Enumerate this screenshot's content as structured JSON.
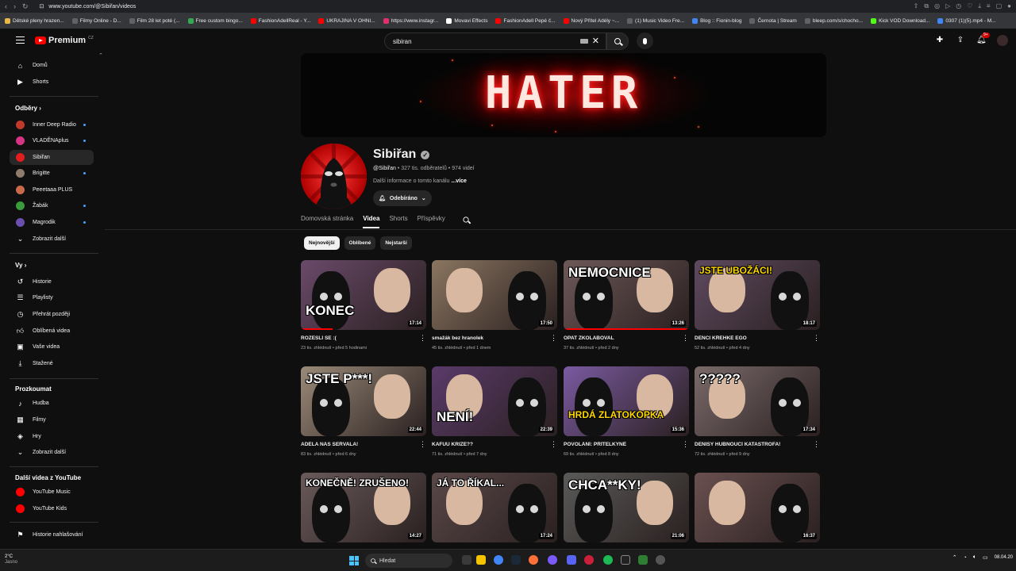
{
  "browser": {
    "url": "www.youtube.com/@Sibiřan/videos",
    "bookmarks": [
      {
        "label": "Dětské pleny hrazen...",
        "color": "#e8b84a"
      },
      {
        "label": "Filmy Online - D...",
        "color": "#5f6368"
      },
      {
        "label": "Film 28 let poté (...",
        "color": "#5f6368"
      },
      {
        "label": "Free custom bingo...",
        "color": "#34a853"
      },
      {
        "label": "FashionAdellReal - Y...",
        "color": "#ff0000"
      },
      {
        "label": "UKRAJINA V OHNI...",
        "color": "#ff0000"
      },
      {
        "label": "https://www.instagr...",
        "color": "#e1306c"
      },
      {
        "label": "Movavi Effects",
        "color": "#ffffff"
      },
      {
        "label": "FashionAdell Pepé č...",
        "color": "#ff0000"
      },
      {
        "label": "Nový Přítel Adély ~...",
        "color": "#ff0000"
      },
      {
        "label": "(1) Music Video Fre...",
        "color": "#5f6368"
      },
      {
        "label": "Blog :: Fionin-blog",
        "color": "#4285f4"
      },
      {
        "label": "Černota | Stream",
        "color": "#5f6368"
      },
      {
        "label": "bleep.com/s/chocho...",
        "color": "#5f6368"
      },
      {
        "label": "Kick VOD Download...",
        "color": "#53fc18"
      },
      {
        "label": "0307 (1)(5).mp4 - M...",
        "color": "#4285f4"
      }
    ]
  },
  "header": {
    "logo_text": "Premium",
    "logo_region": "CZ",
    "search_value": "sibiran",
    "notif_count": "9+"
  },
  "sidebar": {
    "main": [
      {
        "label": "Domů",
        "icon": "home-icon"
      },
      {
        "label": "Shorts",
        "icon": "shorts-icon"
      }
    ],
    "subs_title": "Odběry",
    "subs": [
      {
        "label": "Inner Deep Radio",
        "color": "#c0392b",
        "dot": true
      },
      {
        "label": "VLADĚNAplus",
        "color": "#d63384",
        "dot": true
      },
      {
        "label": "Sibiřan",
        "color": "#e11d1d",
        "dot": false,
        "active": true
      },
      {
        "label": "Brigitte",
        "color": "#8e7b6b",
        "dot": true
      },
      {
        "label": "Peeetaaa PLUS",
        "color": "#c96a4a",
        "dot": false
      },
      {
        "label": "Žabák",
        "color": "#3b9a3b",
        "dot": true
      },
      {
        "label": "Magrodik",
        "color": "#6b4fb0",
        "dot": true
      }
    ],
    "show_more": "Zobrazit další",
    "you_title": "Vy",
    "you": [
      {
        "label": "Historie",
        "icon": "history-icon"
      },
      {
        "label": "Playlisty",
        "icon": "playlist-icon"
      },
      {
        "label": "Přehrát později",
        "icon": "clock-icon"
      },
      {
        "label": "Oblíbená videa",
        "icon": "like-icon"
      },
      {
        "label": "Vaše videa",
        "icon": "video-icon"
      },
      {
        "label": "Stažené",
        "icon": "download-icon"
      }
    ],
    "explore_title": "Prozkoumat",
    "explore": [
      {
        "label": "Hudba",
        "icon": "music-icon"
      },
      {
        "label": "Filmy",
        "icon": "film-icon"
      },
      {
        "label": "Hry",
        "icon": "gamepad-icon"
      }
    ],
    "explore_more": "Zobrazit další",
    "more_title": "Další videa z YouTube",
    "more": [
      {
        "label": "YouTube Music",
        "color": "#ff0000"
      },
      {
        "label": "YouTube Kids",
        "color": "#ff0000"
      }
    ],
    "report": "Historie nahlašování"
  },
  "channel": {
    "banner_text": "HATER",
    "name": "Sibiřan",
    "handle": "@Sibiřan",
    "subs": "327 tis. odběratelů",
    "videos": "974 videí",
    "more_text": "Další informace o tomto kanálu",
    "more_link": "...více",
    "sub_label": "Odebíráno"
  },
  "tabs": [
    "Domovská stránka",
    "Videa",
    "Shorts",
    "Příspěvky"
  ],
  "chips": [
    "Nejnovější",
    "Oblíbené",
    "Nejstarší"
  ],
  "videos": [
    {
      "title": "ROZEŠLI SE :(",
      "meta": "23 tis. zhlédnutí • před 5 hodinami",
      "duration": "17:14",
      "overlay": "KONEC",
      "bg": "#6a4a6a",
      "progress": 0.25
    },
    {
      "title": "smažák bez hranolek",
      "meta": "45 tis. zhlédnutí • před 1 dnem",
      "duration": "17:50",
      "overlay": "",
      "bg": "#8a7560",
      "progress": 0
    },
    {
      "title": "OPAT ZKOLABOVAL",
      "meta": "37 tis. zhlédnutí • před 2 dny",
      "duration": "13:26",
      "overlay": "NEMOCNICE",
      "bg": "#6e5858",
      "progress": 1.0
    },
    {
      "title": "DENČI KŘEHKÉ EGO",
      "meta": "52 tis. zhlédnutí • před 4 dny",
      "duration": "18:17",
      "overlay": "JSTE UBOŽÁCI!",
      "bg": "#5e4a60",
      "progress": 0
    },
    {
      "title": "ADÉLA NÁS SEŘVALA!",
      "meta": "83 tis. zhlédnutí • před 6 dny",
      "duration": "22:44",
      "overlay": "JSTE P***!",
      "bg": "#9a8a78",
      "progress": 0
    },
    {
      "title": "KAFUU KRIZE??",
      "meta": "71 tis. zhlédnutí • před 7 dny",
      "duration": "22:39",
      "overlay": "NENÍ!",
      "bg": "#5a3a6a",
      "progress": 0
    },
    {
      "title": "POVOLÁNÍ: PŘÍTELKYNĚ",
      "meta": "69 tis. zhlédnutí • před 8 dny",
      "duration": "15:36",
      "overlay": "HRDÁ ZLATOKOPKA",
      "bg": "#7a5aa0",
      "progress": 0
    },
    {
      "title": "DENISY HUBNOUCÍ KATASTROFA!",
      "meta": "72 tis. zhlédnutí • před 9 dny",
      "duration": "17:34",
      "overlay": "?????",
      "bg": "#7a6a6a",
      "progress": 0
    },
    {
      "title": "",
      "meta": "",
      "duration": "14:27",
      "overlay": "KONEČNĚ! ZRUŠENO!",
      "bg": "#6a5a5a",
      "progress": 0
    },
    {
      "title": "",
      "meta": "",
      "duration": "17:24",
      "overlay": "JÁ TO ŘÍKAL...",
      "bg": "#5a4848",
      "progress": 0
    },
    {
      "title": "",
      "meta": "",
      "duration": "21:06",
      "overlay": "CHCA**KY!",
      "bg": "#5a5a58",
      "progress": 0
    },
    {
      "title": "",
      "meta": "",
      "duration": "16:37",
      "overlay": "",
      "bg": "#6a5050",
      "progress": 0
    }
  ],
  "taskbar": {
    "temp": "2°C",
    "weather": "Jasno",
    "search": "Hledat",
    "date": "08.04.20"
  }
}
